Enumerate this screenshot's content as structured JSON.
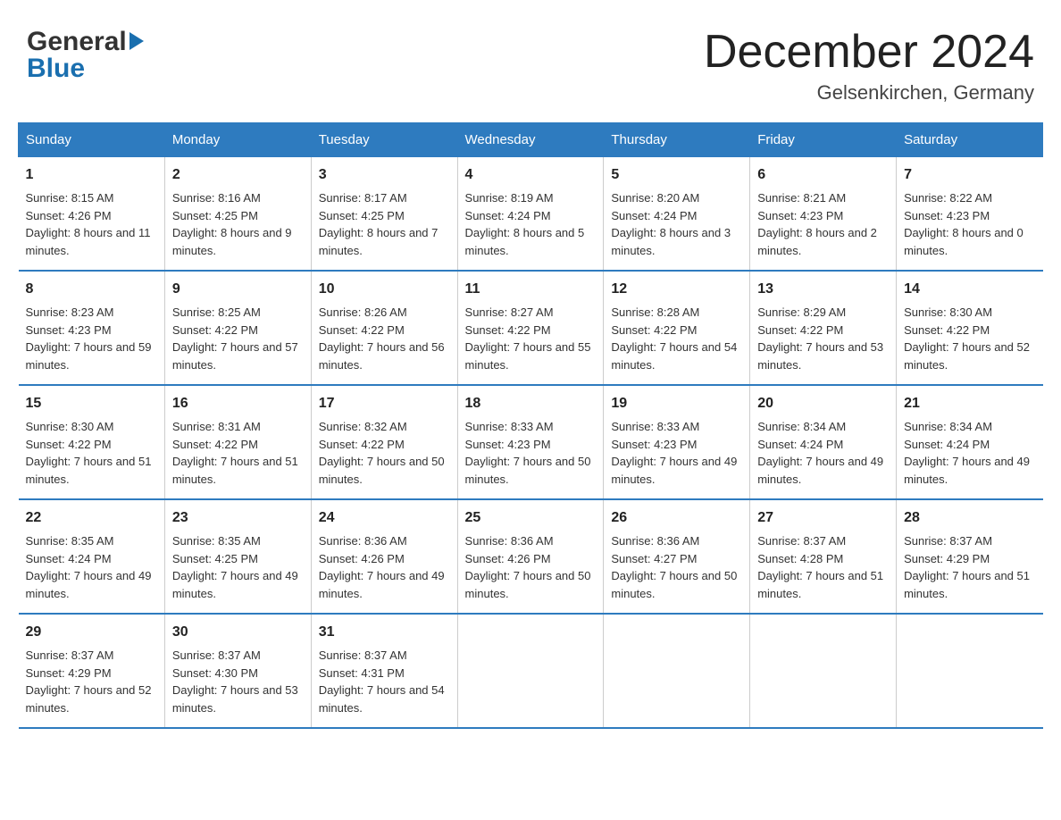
{
  "header": {
    "logo_general": "General",
    "logo_blue": "Blue",
    "month_title": "December 2024",
    "location": "Gelsenkirchen, Germany"
  },
  "days_of_week": [
    "Sunday",
    "Monday",
    "Tuesday",
    "Wednesday",
    "Thursday",
    "Friday",
    "Saturday"
  ],
  "weeks": [
    [
      {
        "day": "1",
        "sunrise": "8:15 AM",
        "sunset": "4:26 PM",
        "daylight": "8 hours and 11 minutes."
      },
      {
        "day": "2",
        "sunrise": "8:16 AM",
        "sunset": "4:25 PM",
        "daylight": "8 hours and 9 minutes."
      },
      {
        "day": "3",
        "sunrise": "8:17 AM",
        "sunset": "4:25 PM",
        "daylight": "8 hours and 7 minutes."
      },
      {
        "day": "4",
        "sunrise": "8:19 AM",
        "sunset": "4:24 PM",
        "daylight": "8 hours and 5 minutes."
      },
      {
        "day": "5",
        "sunrise": "8:20 AM",
        "sunset": "4:24 PM",
        "daylight": "8 hours and 3 minutes."
      },
      {
        "day": "6",
        "sunrise": "8:21 AM",
        "sunset": "4:23 PM",
        "daylight": "8 hours and 2 minutes."
      },
      {
        "day": "7",
        "sunrise": "8:22 AM",
        "sunset": "4:23 PM",
        "daylight": "8 hours and 0 minutes."
      }
    ],
    [
      {
        "day": "8",
        "sunrise": "8:23 AM",
        "sunset": "4:23 PM",
        "daylight": "7 hours and 59 minutes."
      },
      {
        "day": "9",
        "sunrise": "8:25 AM",
        "sunset": "4:22 PM",
        "daylight": "7 hours and 57 minutes."
      },
      {
        "day": "10",
        "sunrise": "8:26 AM",
        "sunset": "4:22 PM",
        "daylight": "7 hours and 56 minutes."
      },
      {
        "day": "11",
        "sunrise": "8:27 AM",
        "sunset": "4:22 PM",
        "daylight": "7 hours and 55 minutes."
      },
      {
        "day": "12",
        "sunrise": "8:28 AM",
        "sunset": "4:22 PM",
        "daylight": "7 hours and 54 minutes."
      },
      {
        "day": "13",
        "sunrise": "8:29 AM",
        "sunset": "4:22 PM",
        "daylight": "7 hours and 53 minutes."
      },
      {
        "day": "14",
        "sunrise": "8:30 AM",
        "sunset": "4:22 PM",
        "daylight": "7 hours and 52 minutes."
      }
    ],
    [
      {
        "day": "15",
        "sunrise": "8:30 AM",
        "sunset": "4:22 PM",
        "daylight": "7 hours and 51 minutes."
      },
      {
        "day": "16",
        "sunrise": "8:31 AM",
        "sunset": "4:22 PM",
        "daylight": "7 hours and 51 minutes."
      },
      {
        "day": "17",
        "sunrise": "8:32 AM",
        "sunset": "4:22 PM",
        "daylight": "7 hours and 50 minutes."
      },
      {
        "day": "18",
        "sunrise": "8:33 AM",
        "sunset": "4:23 PM",
        "daylight": "7 hours and 50 minutes."
      },
      {
        "day": "19",
        "sunrise": "8:33 AM",
        "sunset": "4:23 PM",
        "daylight": "7 hours and 49 minutes."
      },
      {
        "day": "20",
        "sunrise": "8:34 AM",
        "sunset": "4:24 PM",
        "daylight": "7 hours and 49 minutes."
      },
      {
        "day": "21",
        "sunrise": "8:34 AM",
        "sunset": "4:24 PM",
        "daylight": "7 hours and 49 minutes."
      }
    ],
    [
      {
        "day": "22",
        "sunrise": "8:35 AM",
        "sunset": "4:24 PM",
        "daylight": "7 hours and 49 minutes."
      },
      {
        "day": "23",
        "sunrise": "8:35 AM",
        "sunset": "4:25 PM",
        "daylight": "7 hours and 49 minutes."
      },
      {
        "day": "24",
        "sunrise": "8:36 AM",
        "sunset": "4:26 PM",
        "daylight": "7 hours and 49 minutes."
      },
      {
        "day": "25",
        "sunrise": "8:36 AM",
        "sunset": "4:26 PM",
        "daylight": "7 hours and 50 minutes."
      },
      {
        "day": "26",
        "sunrise": "8:36 AM",
        "sunset": "4:27 PM",
        "daylight": "7 hours and 50 minutes."
      },
      {
        "day": "27",
        "sunrise": "8:37 AM",
        "sunset": "4:28 PM",
        "daylight": "7 hours and 51 minutes."
      },
      {
        "day": "28",
        "sunrise": "8:37 AM",
        "sunset": "4:29 PM",
        "daylight": "7 hours and 51 minutes."
      }
    ],
    [
      {
        "day": "29",
        "sunrise": "8:37 AM",
        "sunset": "4:29 PM",
        "daylight": "7 hours and 52 minutes."
      },
      {
        "day": "30",
        "sunrise": "8:37 AM",
        "sunset": "4:30 PM",
        "daylight": "7 hours and 53 minutes."
      },
      {
        "day": "31",
        "sunrise": "8:37 AM",
        "sunset": "4:31 PM",
        "daylight": "7 hours and 54 minutes."
      },
      null,
      null,
      null,
      null
    ]
  ]
}
